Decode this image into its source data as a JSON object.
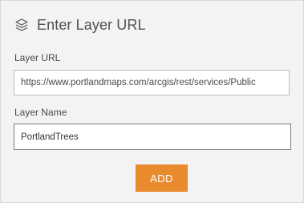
{
  "dialog": {
    "title": "Enter Layer URL",
    "title_icon": "layers-icon"
  },
  "fields": {
    "url": {
      "label": "Layer URL",
      "value": "https://www.portlandmaps.com/arcgis/rest/services/Public"
    },
    "name": {
      "label": "Layer Name",
      "value": "PortlandTrees"
    }
  },
  "actions": {
    "add_label": "ADD"
  },
  "colors": {
    "panel_background": "#f3f3f3",
    "accent_button": "#ea8a2e",
    "focused_border": "#6e7c8c"
  }
}
